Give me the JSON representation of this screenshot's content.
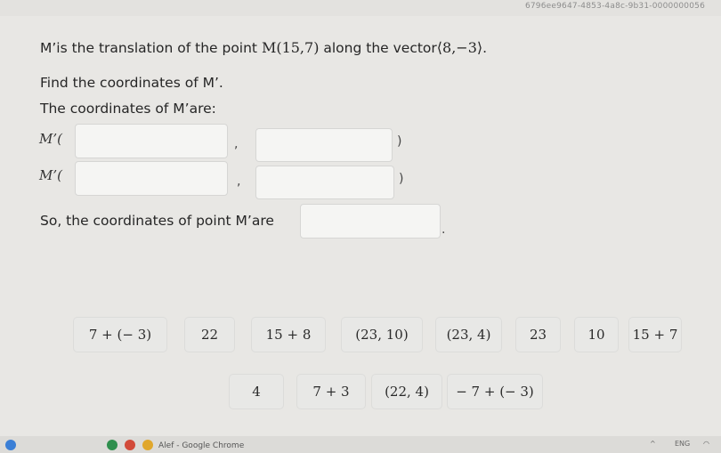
{
  "browser": {
    "url_fragment": "6796ee9647-4853-4a8c-9b31-0000000056"
  },
  "question": {
    "line1_prefix": "M’is the translation of the point ",
    "point": "M(15,7)",
    "line1_middle": " along the vector",
    "vector": "⟨8,−3⟩",
    "line1_suffix": ".",
    "line2": "Find the coordinates of M’.",
    "line3": "The coordinates of M’are:",
    "row_label": "M’(",
    "comma": ",",
    "close_paren": ")",
    "final_text": "So, the coordinates of point M’are",
    "final_period": "."
  },
  "tiles_row1": [
    "7 + (− 3)",
    "22",
    "15 + 8",
    "(23, 10)",
    "(23, 4)",
    "23",
    "10",
    "15 + 7"
  ],
  "tiles_row2": [
    "4",
    "7 + 3",
    "(22, 4)",
    "− 7 + (− 3)"
  ],
  "taskbar": {
    "app_label": "Alef - Google Chrome",
    "lang": "ENG"
  }
}
